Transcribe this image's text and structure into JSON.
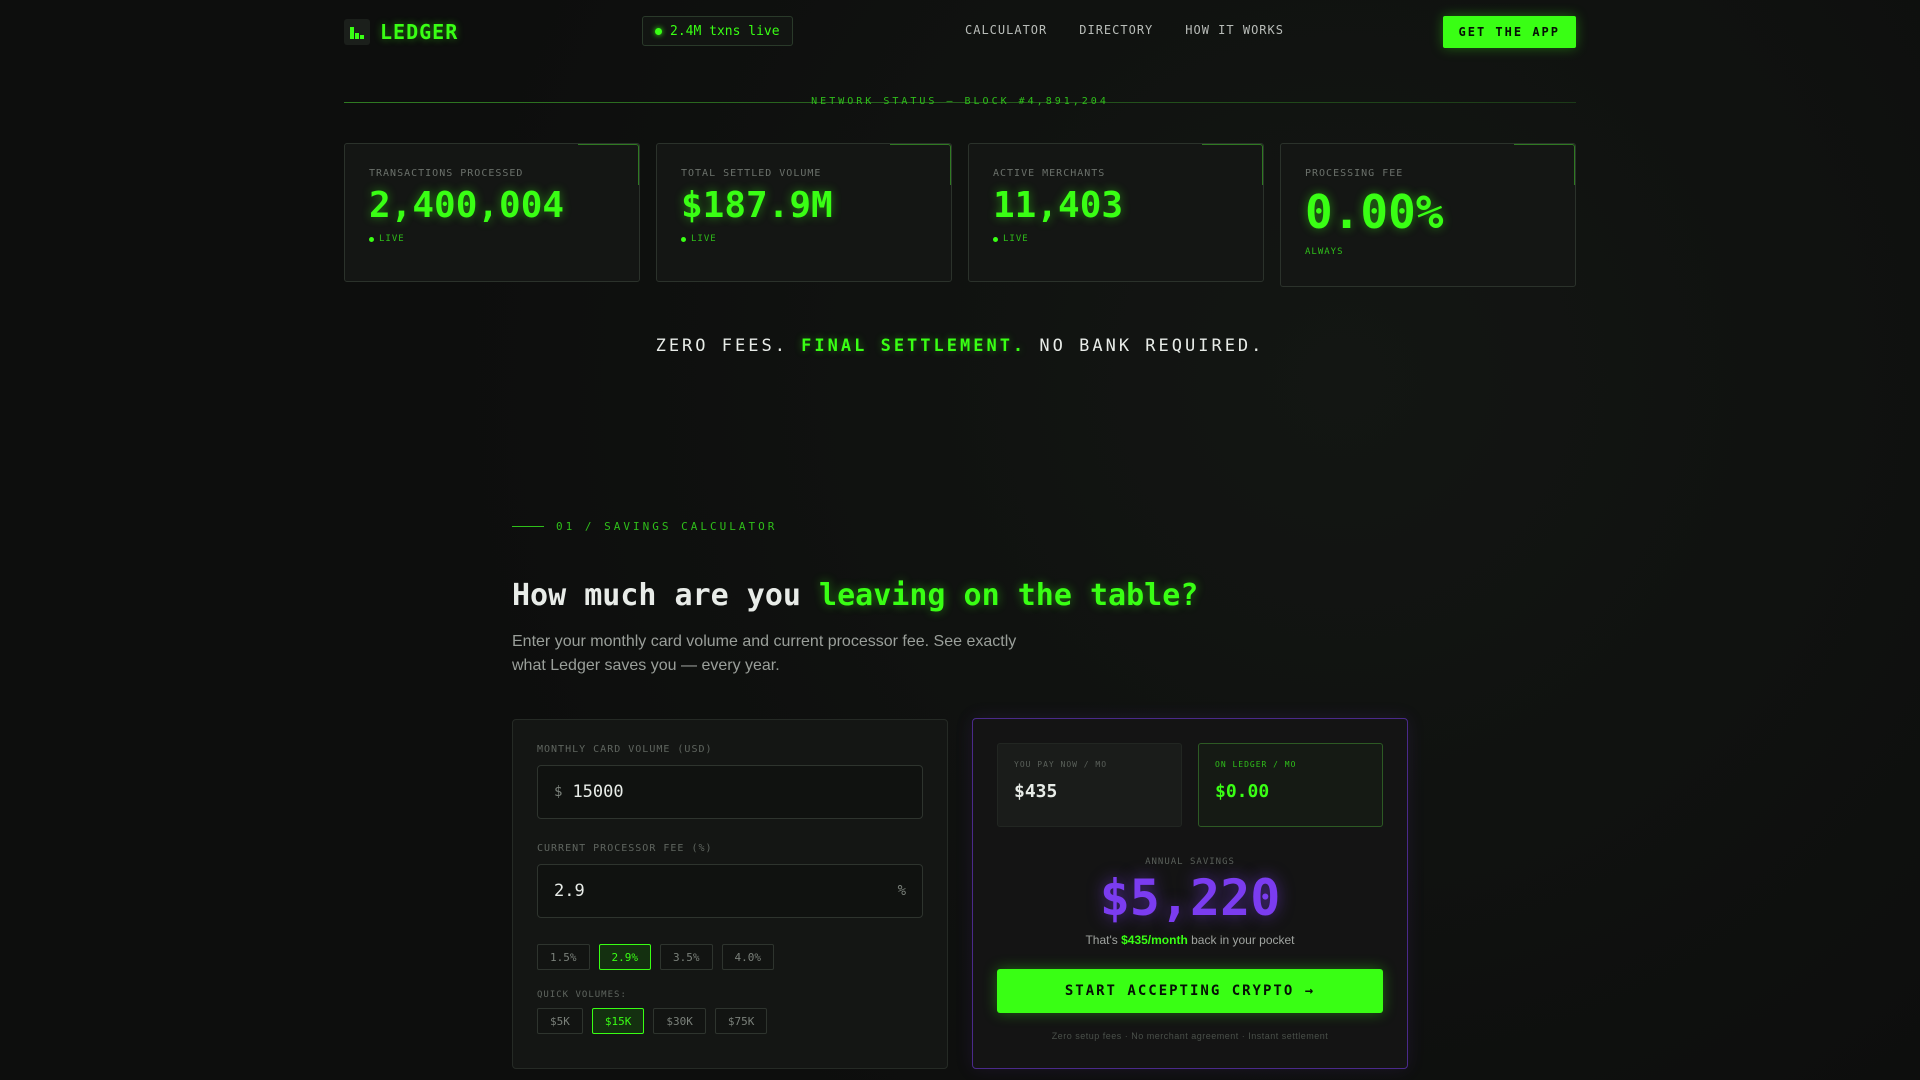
{
  "nav": {
    "logo": "LEDGER",
    "live_pill": "2.4M txns live",
    "links": [
      "CALCULATOR",
      "DIRECTORY",
      "HOW IT WORKS"
    ],
    "cta": "GET THE APP"
  },
  "network_status": "NETWORK STATUS — BLOCK #4,891,204",
  "stats": [
    {
      "label": "TRANSACTIONS PROCESSED",
      "value": "2,400,004",
      "sub": "LIVE"
    },
    {
      "label": "TOTAL SETTLED VOLUME",
      "value": "$187.9M",
      "sub": "LIVE"
    },
    {
      "label": "ACTIVE MERCHANTS",
      "value": "11,403",
      "sub": "LIVE"
    },
    {
      "label": "PROCESSING FEE",
      "value": "0.00%",
      "sub": "ALWAYS"
    }
  ],
  "tagline": {
    "part1": "ZERO FEES. ",
    "highlight": "FINAL SETTLEMENT.",
    "part2": " NO BANK REQUIRED."
  },
  "section": {
    "eyebrow": "01 / SAVINGS CALCULATOR",
    "headline_part1": "How much are you ",
    "headline_highlight": "leaving on the table?",
    "lede": "Enter your monthly card volume and current processor fee. See exactly what Ledger saves you — every year."
  },
  "calculator": {
    "volume_label": "MONTHLY CARD VOLUME (USD)",
    "volume_prefix": "$",
    "volume_value": "15000",
    "fee_label": "CURRENT PROCESSOR FEE (%)",
    "fee_value": "2.9",
    "fee_suffix": "%",
    "fee_chips": [
      "1.5%",
      "2.9%",
      "3.5%",
      "4.0%"
    ],
    "fee_selected": "2.9%",
    "quick_label": "QUICK VOLUMES:",
    "volume_chips": [
      "$5K",
      "$15K",
      "$30K",
      "$75K"
    ],
    "volume_selected": "$15K"
  },
  "results": {
    "pay_now_label": "YOU PAY NOW / MO",
    "pay_now_value": "$435",
    "ledger_label": "ON LEDGER / MO",
    "ledger_value": "$0.00",
    "annual_label": "ANNUAL SAVINGS",
    "annual_value": "$5,220",
    "note_pre": "That's ",
    "note_highlight": "$435/month",
    "note_post": " back in your pocket",
    "cta": "START ACCEPTING CRYPTO →",
    "footnote": "Zero setup fees · No merchant agreement · Instant settlement"
  },
  "colors": {
    "accent": "#39ff14",
    "purple": "#7b3cf0",
    "background": "#0d0e0d"
  }
}
